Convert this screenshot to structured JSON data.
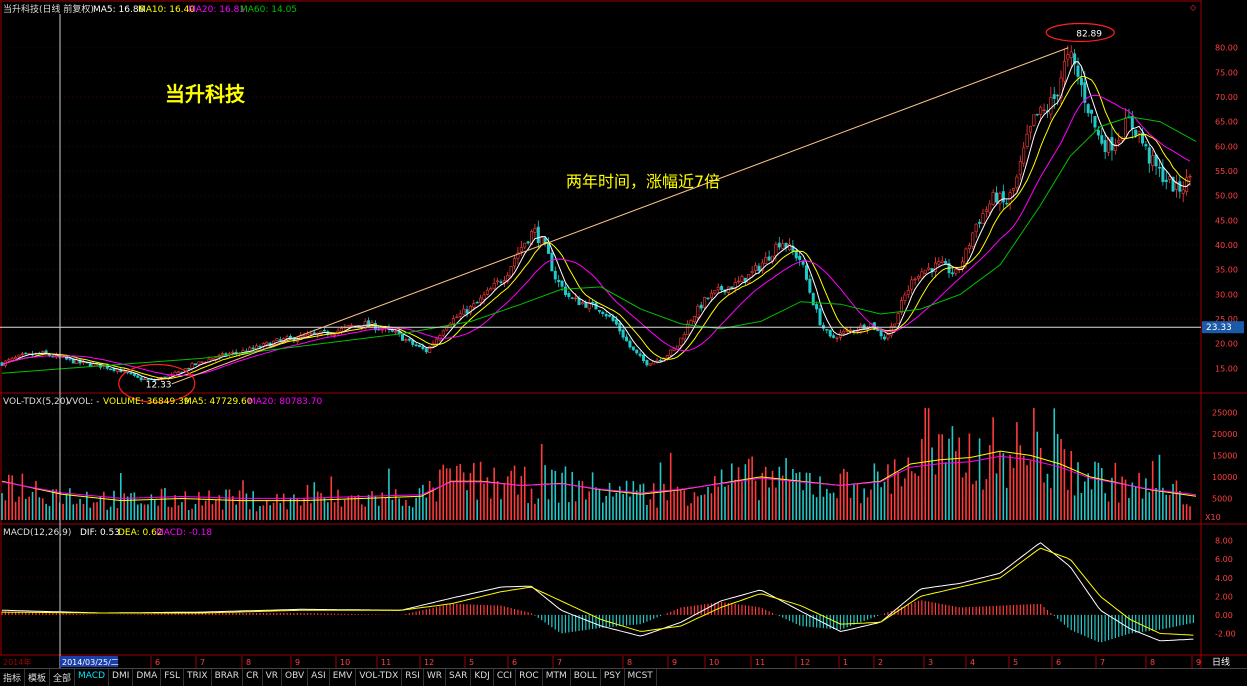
{
  "colors": {
    "up": "#ff3b3b",
    "down": "#22c9c9",
    "ma5": "#ffffff",
    "ma10": "#ffff00",
    "ma20": "#ff00ff",
    "ma60": "#00c000",
    "axis": "#c00000",
    "axis_text": "#ff4040",
    "callout": "#ffff00",
    "title": "#ffff00"
  },
  "top_bar": {
    "title": "当升科技(日线 前复权)",
    "ma5": "MA5: 16.86",
    "ma10": "MA10: 16.40",
    "ma20": "MA20: 16.81",
    "ma60": "MA60: 14.05"
  },
  "stock_name": "当升科技",
  "callout": "两年时间，涨幅近7倍",
  "low_label": "12.33",
  "high_label": "82.89",
  "current_price": "23.33",
  "vol_bar": {
    "name": "VOL-TDX(5,20)",
    "vvol": "VVOL: -",
    "volume": "VOLUME: 36849.39",
    "ma5": "MA5: 47729.60",
    "ma20": "MA20: 80783.70"
  },
  "vol_unit": "X10",
  "macd_bar": {
    "name": "MACD(12,26,9)",
    "dif": "DIF: 0.53",
    "dea": "DEA: 0.62",
    "macd": "MACD: -0.18"
  },
  "x_axis": {
    "first": "2014年",
    "cursor_date": "2014/03/25/二",
    "months": [
      "6",
      "7",
      "8",
      "9",
      "10",
      "11",
      "12",
      "5",
      "6",
      "7",
      "8",
      "9",
      "10",
      "11",
      "12",
      "1",
      "2",
      "3",
      "4",
      "5",
      "6",
      "7",
      "8",
      "9",
      "10"
    ],
    "period_label": "日线"
  },
  "tabs": [
    "指标",
    "模板",
    "全部",
    "MACD",
    "DMI",
    "DMA",
    "FSL",
    "TRIX",
    "BRAR",
    "CR",
    "VR",
    "OBV",
    "ASI",
    "EMV",
    "VOL-TDX",
    "RSI",
    "WR",
    "SAR",
    "KDJ",
    "CCI",
    "ROC",
    "MTM",
    "BOLL",
    "PSY",
    "MCST"
  ],
  "active_tab": "MACD",
  "chart_data": {
    "type": "candlestick",
    "title": "当升科技(日线 前复权)",
    "price_ticks": [
      "80.00",
      "75.00",
      "70.00",
      "65.00",
      "60.00",
      "55.00",
      "50.00",
      "45.00",
      "40.00",
      "35.00",
      "30.00",
      "25.00",
      "20.00",
      "15.00"
    ],
    "price_ylim": [
      11,
      84
    ],
    "price_path": {
      "x": [
        0,
        20,
        40,
        60,
        80,
        100,
        120,
        135,
        150,
        170,
        190,
        210,
        230,
        245,
        260,
        275,
        290,
        305,
        320,
        335,
        350,
        365,
        380,
        395,
        410,
        425,
        435,
        445,
        460,
        475,
        490,
        505,
        515,
        525,
        533,
        545,
        555,
        570,
        585,
        600,
        615,
        630,
        645,
        660,
        675,
        690,
        705,
        720,
        735,
        750,
        765,
        780,
        790,
        800,
        810,
        820,
        830,
        840,
        855,
        870,
        885,
        895,
        905,
        915,
        925,
        940,
        955,
        965,
        975,
        985,
        995,
        1005,
        1015,
        1025,
        1035,
        1045,
        1055,
        1063,
        1070,
        1078,
        1088,
        1098,
        1108,
        1118,
        1128,
        1138,
        1148,
        1158,
        1168,
        1178,
        1188,
        1196
      ],
      "y": [
        16,
        17.5,
        18,
        17,
        16,
        15.5,
        14.5,
        13,
        12.5,
        13.5,
        15.5,
        17,
        18,
        18.5,
        19.5,
        20.5,
        21,
        21.5,
        22,
        22.5,
        23.5,
        24,
        23,
        22,
        20,
        18.5,
        21,
        24,
        26,
        28,
        31,
        34,
        38,
        41,
        43,
        39,
        33,
        29,
        28,
        27,
        24,
        19,
        16,
        17,
        19,
        25,
        29,
        31,
        32,
        34,
        37,
        41,
        39,
        37,
        30,
        24,
        21,
        22,
        23,
        24,
        21,
        25,
        30,
        34,
        35,
        36,
        34,
        38,
        44,
        47,
        50,
        48,
        52,
        60,
        66,
        67,
        70,
        76,
        78,
        74,
        68,
        62,
        60,
        62,
        65,
        63,
        58,
        55,
        53,
        51,
        53,
        57
      ]
    },
    "ma60_path": {
      "x": [
        0,
        100,
        200,
        300,
        400,
        470,
        520,
        560,
        600,
        640,
        680,
        720,
        760,
        800,
        840,
        880,
        920,
        960,
        1000,
        1040,
        1070,
        1100,
        1130,
        1160,
        1196
      ],
      "y": [
        14,
        15.5,
        17,
        19.5,
        22,
        24.5,
        28,
        31,
        31.5,
        27,
        24,
        23,
        24.5,
        28.5,
        28,
        26,
        27,
        30,
        36,
        48,
        58,
        64,
        66,
        65,
        61
      ]
    },
    "vol_ticks": [
      "25000",
      "20000",
      "15000",
      "10000",
      "5000"
    ],
    "vol_ylim": [
      0,
      26000
    ],
    "vol_ma_path": {
      "x": [
        0,
        60,
        120,
        180,
        240,
        300,
        360,
        420,
        450,
        480,
        520,
        560,
        600,
        640,
        680,
        720,
        760,
        800,
        840,
        880,
        910,
        940,
        970,
        1000,
        1030,
        1060,
        1090,
        1120,
        1150,
        1196
      ],
      "y": [
        9000,
        6000,
        4500,
        5000,
        4500,
        4500,
        5000,
        5500,
        9000,
        9000,
        8000,
        8500,
        7000,
        6000,
        7000,
        8500,
        10000,
        9000,
        8000,
        9000,
        13000,
        14000,
        14500,
        16000,
        15000,
        13000,
        10000,
        8500,
        7000,
        5500
      ]
    },
    "macd_ticks": [
      "8.00",
      "6.00",
      "4.00",
      "2.00",
      "0.00",
      "-2.00"
    ],
    "macd_ylim": [
      -4,
      8.5
    ],
    "dif_path": {
      "x": [
        0,
        100,
        200,
        300,
        400,
        450,
        500,
        530,
        560,
        600,
        640,
        680,
        720,
        760,
        800,
        840,
        880,
        920,
        960,
        1000,
        1040,
        1070,
        1100,
        1130,
        1160,
        1196
      ],
      "y": [
        0.5,
        0.2,
        0.3,
        0.6,
        0.5,
        1.8,
        3,
        3.1,
        0.5,
        -1.2,
        -2.3,
        -0.8,
        1.5,
        2.7,
        0.4,
        -1.8,
        -0.8,
        2.8,
        3.4,
        4.5,
        7.8,
        5.2,
        0.5,
        -1.5,
        -2.8,
        -2.6
      ]
    },
    "dea_path": {
      "x": [
        0,
        100,
        200,
        300,
        400,
        450,
        500,
        530,
        560,
        600,
        640,
        680,
        720,
        760,
        800,
        840,
        880,
        920,
        960,
        1000,
        1040,
        1070,
        1100,
        1130,
        1160,
        1196
      ],
      "y": [
        0.3,
        0.2,
        0.2,
        0.5,
        0.5,
        1.2,
        2.5,
        3,
        1.5,
        -0.5,
        -1.8,
        -1.2,
        0.8,
        2.3,
        1,
        -1,
        -0.8,
        2,
        3,
        4,
        7.2,
        6,
        2,
        -0.5,
        -2,
        -2.2
      ]
    }
  }
}
